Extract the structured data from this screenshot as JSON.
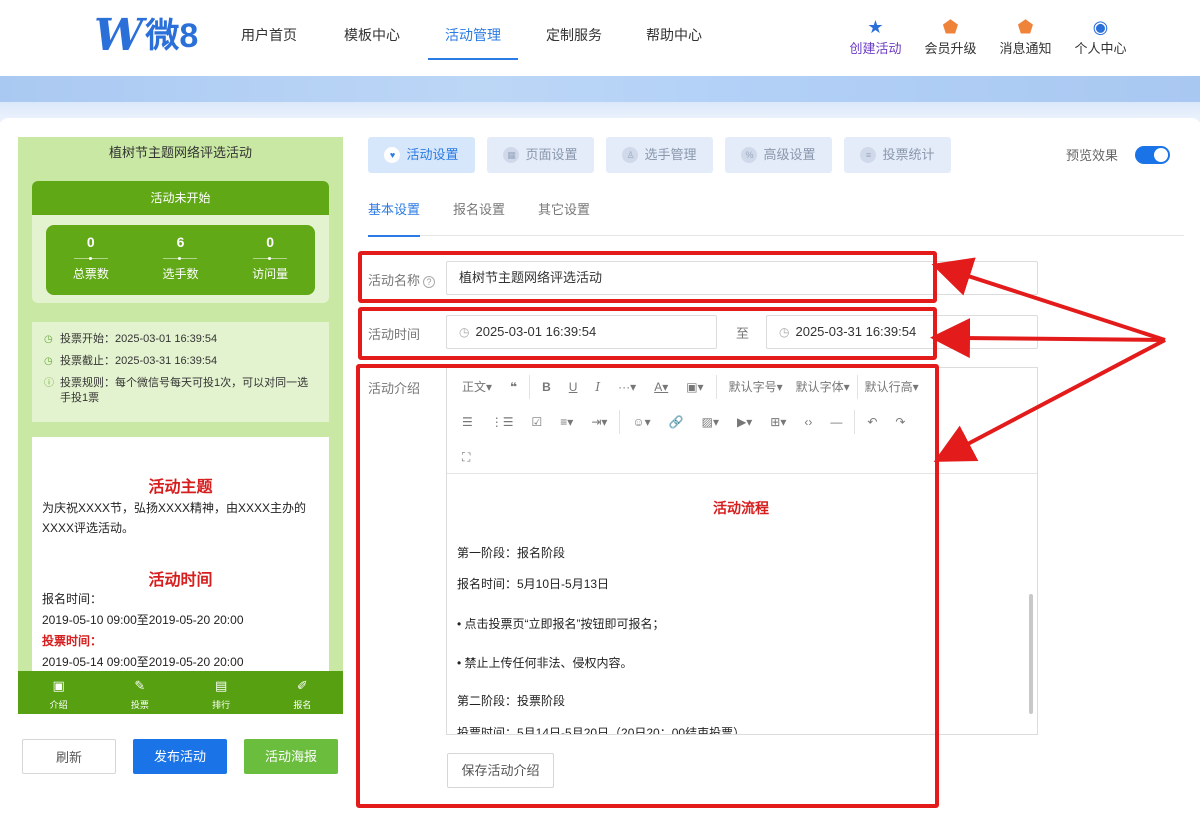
{
  "header": {
    "logo_w": "W",
    "logo_text": "微8",
    "nav": [
      {
        "label": "用户首页"
      },
      {
        "label": "模板中心"
      },
      {
        "label": "活动管理"
      },
      {
        "label": "定制服务"
      },
      {
        "label": "帮助中心"
      }
    ],
    "tools": [
      {
        "label": "创建活动",
        "icon": "sparkle-star-icon"
      },
      {
        "label": "会员升级",
        "icon": "crown-badge-icon"
      },
      {
        "label": "消息通知",
        "icon": "message-badge-icon"
      },
      {
        "label": "个人中心",
        "icon": "user-circle-icon"
      }
    ]
  },
  "phone": {
    "title": "植树节主题网络评选活动",
    "status": "活动未开始",
    "stats": [
      {
        "value": "0",
        "label": "总票数"
      },
      {
        "value": "6",
        "label": "选手数"
      },
      {
        "value": "0",
        "label": "访问量"
      }
    ],
    "info": {
      "start": "投票开始：2025-03-01 16:39:54",
      "end": "投票截止：2025-03-31 16:39:54",
      "rule": "投票规则：每个微信号每天可投1次，可以对同一选手投1票"
    },
    "theme_title": "活动主题",
    "theme_text": "为庆祝XXXX节，弘扬XXXX精神，由XXXX主办的XXXX评选活动。",
    "time_title": "活动时间",
    "signup_label": "报名时间：",
    "signup_time": "2019-05-10 09:00至2019-05-20 20:00",
    "vote_label": "投票时间：",
    "vote_time": "2019-05-14 09:00至2019-05-20 20:00",
    "tabbar": [
      {
        "label": "介绍",
        "icon": "document-icon"
      },
      {
        "label": "投票",
        "icon": "vote-icon"
      },
      {
        "label": "排行",
        "icon": "chart-icon"
      },
      {
        "label": "报名",
        "icon": "edit-icon"
      }
    ]
  },
  "buttons": {
    "refresh": "刷新",
    "publish": "发布活动",
    "poster": "活动海报"
  },
  "top_tabs": [
    {
      "label": "活动设置",
      "active": true
    },
    {
      "label": "页面设置"
    },
    {
      "label": "选手管理"
    },
    {
      "label": "高级设置"
    },
    {
      "label": "投票统计"
    }
  ],
  "preview_label": "预览效果",
  "sub_tabs": [
    {
      "label": "基本设置",
      "active": true
    },
    {
      "label": "报名设置"
    },
    {
      "label": "其它设置"
    }
  ],
  "form": {
    "name_label": "活动名称",
    "name_value": "植树节主题网络评选活动",
    "time_label": "活动时间",
    "time_start": "2025-03-01 16:39:54",
    "time_sep": "至",
    "time_end": "2025-03-31 16:39:54",
    "intro_label": "活动介绍"
  },
  "editor": {
    "toolbar_row1": [
      "正文▾",
      "❝",
      "B",
      "U",
      "I",
      "···▾",
      "A▾",
      "▣▾",
      "默认字号▾",
      "默认字体▾",
      "默认行高▾"
    ],
    "toolbar_row2": [
      "☰",
      "⋮☰",
      "☑",
      "≡▾",
      "⇥▾",
      "☺▾",
      "🔗",
      "▨▾",
      "▶▾",
      "⊞▾",
      "‹›",
      "―",
      "↶",
      "↷"
    ],
    "toolbar_row3": [
      "⛶"
    ],
    "content_title": "活动流程",
    "lines": [
      "第一阶段：报名阶段",
      "报名时间：5月10日-5月13日",
      "• 点击投票页“立即报名”按钮即可报名；",
      "• 禁止上传任何非法、侵权内容。",
      "第二阶段：投票阶段",
      "投票时间：5月14日-5月20日（20日20：00结束投票）"
    ],
    "save": "保存活动介绍"
  },
  "colors": {
    "primary": "#1a74e8",
    "highlight": "#e31b1b",
    "phone_bg": "#c9e8a3",
    "phone_green": "#61a817"
  }
}
